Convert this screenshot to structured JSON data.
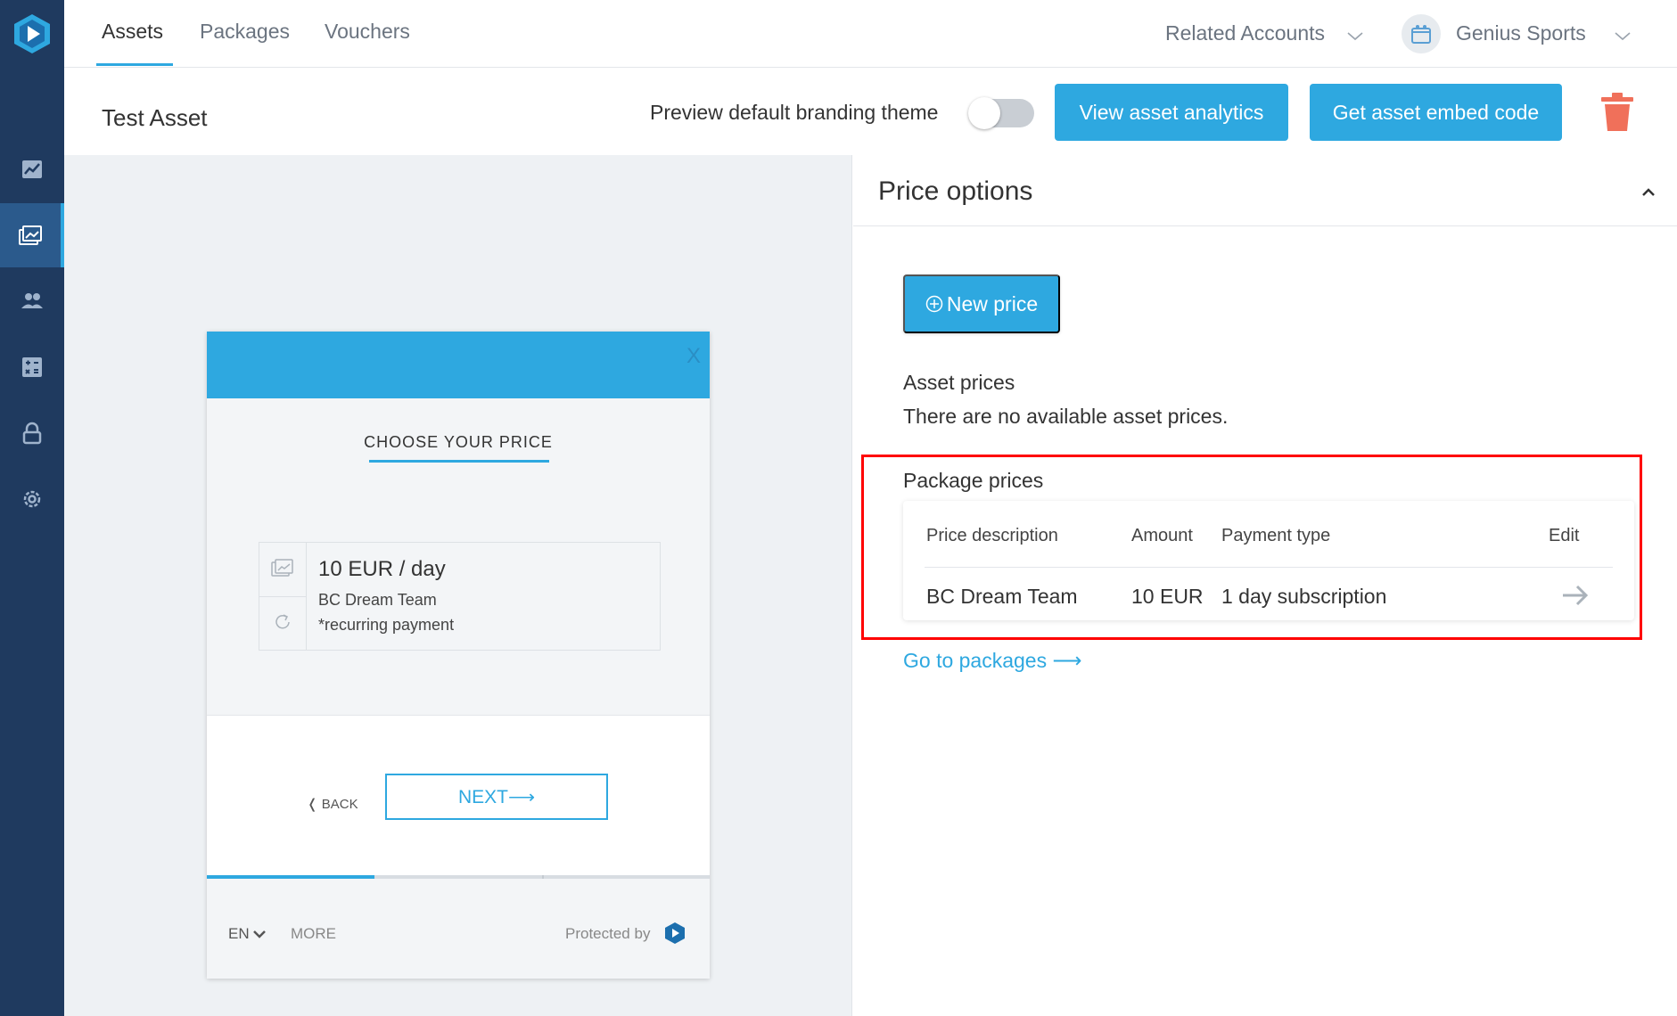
{
  "nav": {
    "tabs": [
      {
        "label": "Assets"
      },
      {
        "label": "Packages"
      },
      {
        "label": "Vouchers"
      }
    ],
    "related_accounts": "Related Accounts",
    "account_name": "Genius Sports"
  },
  "sidebar": {
    "items": [
      {
        "icon": "analytics-icon"
      },
      {
        "icon": "assets-icon"
      },
      {
        "icon": "users-icon"
      },
      {
        "icon": "calculator-icon"
      },
      {
        "icon": "lock-icon"
      },
      {
        "icon": "settings-icon"
      }
    ]
  },
  "header": {
    "title": "Test Asset",
    "preview_label": "Preview default branding theme",
    "view_analytics": "View asset analytics",
    "embed_code": "Get asset embed code"
  },
  "preview": {
    "close": "X",
    "choose": "CHOOSE YOUR PRICE",
    "price_title": "10 EUR / day",
    "price_name": "BC Dream Team",
    "price_note": "*recurring payment",
    "back": "❬ BACK",
    "next": "NEXT⟶",
    "lang": "EN",
    "more": "MORE",
    "protected": "Protected by"
  },
  "price_options": {
    "title": "Price options",
    "new_price": "New price",
    "asset_prices_heading": "Asset prices",
    "no_asset_prices": "There are no available asset prices.",
    "package_prices_heading": "Package prices",
    "columns": [
      "Price description",
      "Amount",
      "Payment type",
      "Edit"
    ],
    "rows": [
      {
        "description": "BC Dream Team",
        "amount": "10 EUR",
        "payment_type": "1 day subscription"
      }
    ],
    "go_to_packages": "Go to packages ⟶"
  },
  "colors": {
    "accent": "#2ea8e0",
    "sidebar": "#1f3a5f",
    "highlight": "#ff0000",
    "danger": "#f0705a"
  }
}
